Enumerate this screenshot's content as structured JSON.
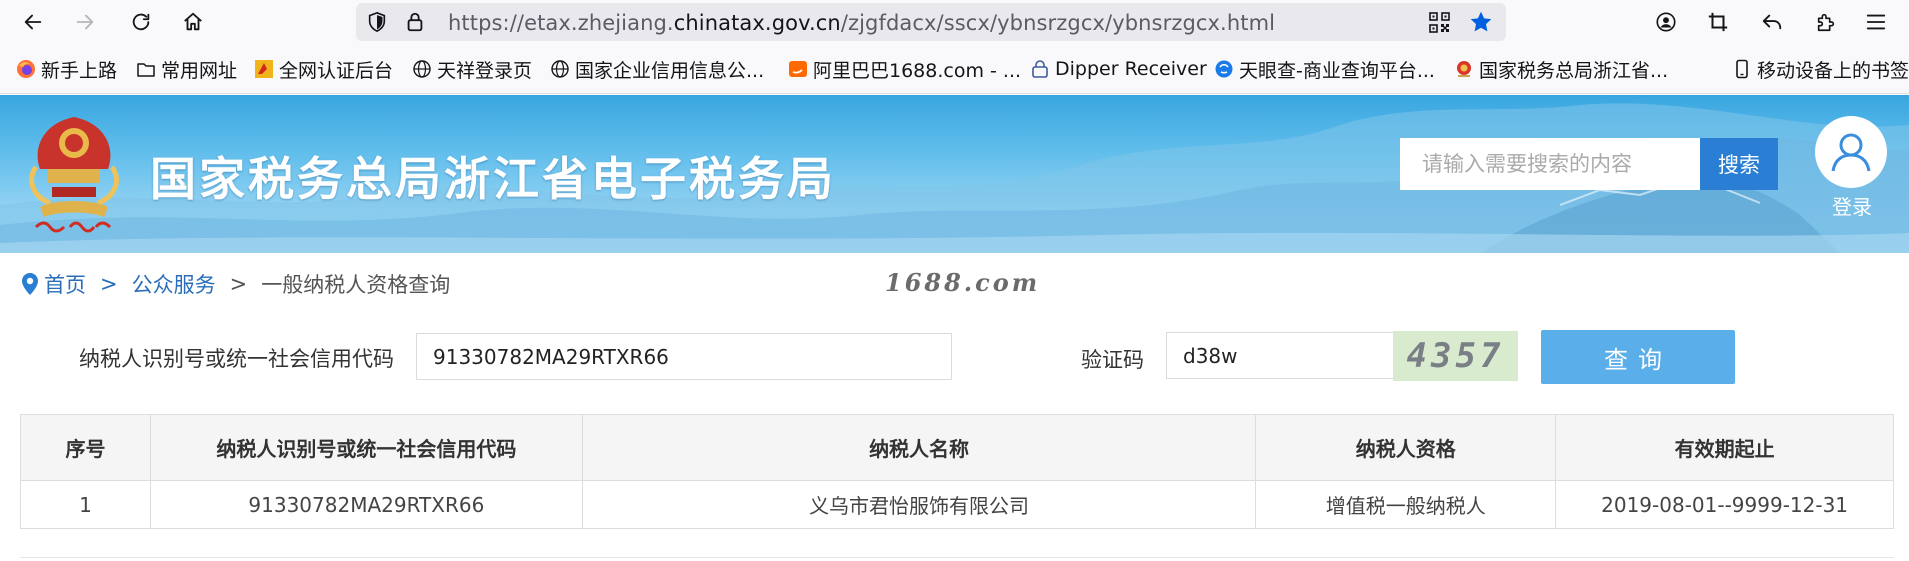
{
  "browser": {
    "url_prefix": "https://etax.zhejiang.",
    "url_domain": "chinatax.gov.cn",
    "url_path": "/zjgfdacx/sscx/ybnsrzgcx/ybnsrzgcx.html"
  },
  "bookmarks": [
    {
      "label": "新手上路",
      "icon": "firefox-icon"
    },
    {
      "label": "常用网址",
      "icon": "folder-icon"
    },
    {
      "label": "全网认证后台",
      "icon": "brand-icon"
    },
    {
      "label": "天祥登录页",
      "icon": "globe-icon"
    },
    {
      "label": "国家企业信用信息公...",
      "icon": "globe-icon"
    },
    {
      "label": "阿里巴巴1688.com - ...",
      "icon": "alibaba-icon"
    },
    {
      "label": "Dipper Receiver",
      "icon": "lock-icon"
    },
    {
      "label": "天眼查-商业查询平台...",
      "icon": "tianyancha-icon"
    },
    {
      "label": "国家税务总局浙江省...",
      "icon": "emblem-icon"
    },
    {
      "label": "移动设备上的书签",
      "icon": "mobile-icon"
    }
  ],
  "banner": {
    "title": "国家税务总局浙江省电子税务局",
    "search_placeholder": "请输入需要搜索的内容",
    "search_label": "搜索",
    "login_label": "登录"
  },
  "breadcrumb": {
    "home": "首页",
    "sep": ">",
    "public_service": "公众服务",
    "current": "一般纳税人资格查询"
  },
  "watermark": "1688.com",
  "form": {
    "taxpayer_id_label": "纳税人识别号或统一社会信用代码",
    "taxpayer_id_value": "91330782MA29RTXR66",
    "captcha_label": "验证码",
    "captcha_value": "d38w",
    "captcha_image_text": "4357",
    "query_label": "查询"
  },
  "table": {
    "headers": [
      "序号",
      "纳税人识别号或统一社会信用代码",
      "纳税人名称",
      "纳税人资格",
      "有效期起止"
    ],
    "rows": [
      [
        "1",
        "91330782MA29RTXR66",
        "义乌市君怡服饰有限公司",
        "增值税一般纳税人",
        "2019-08-01--9999-12-31"
      ]
    ]
  },
  "colors": {
    "accent": "#2a7fd4",
    "query_button": "#5aaee9",
    "link": "#2a6ebb",
    "star": "#0060df"
  }
}
